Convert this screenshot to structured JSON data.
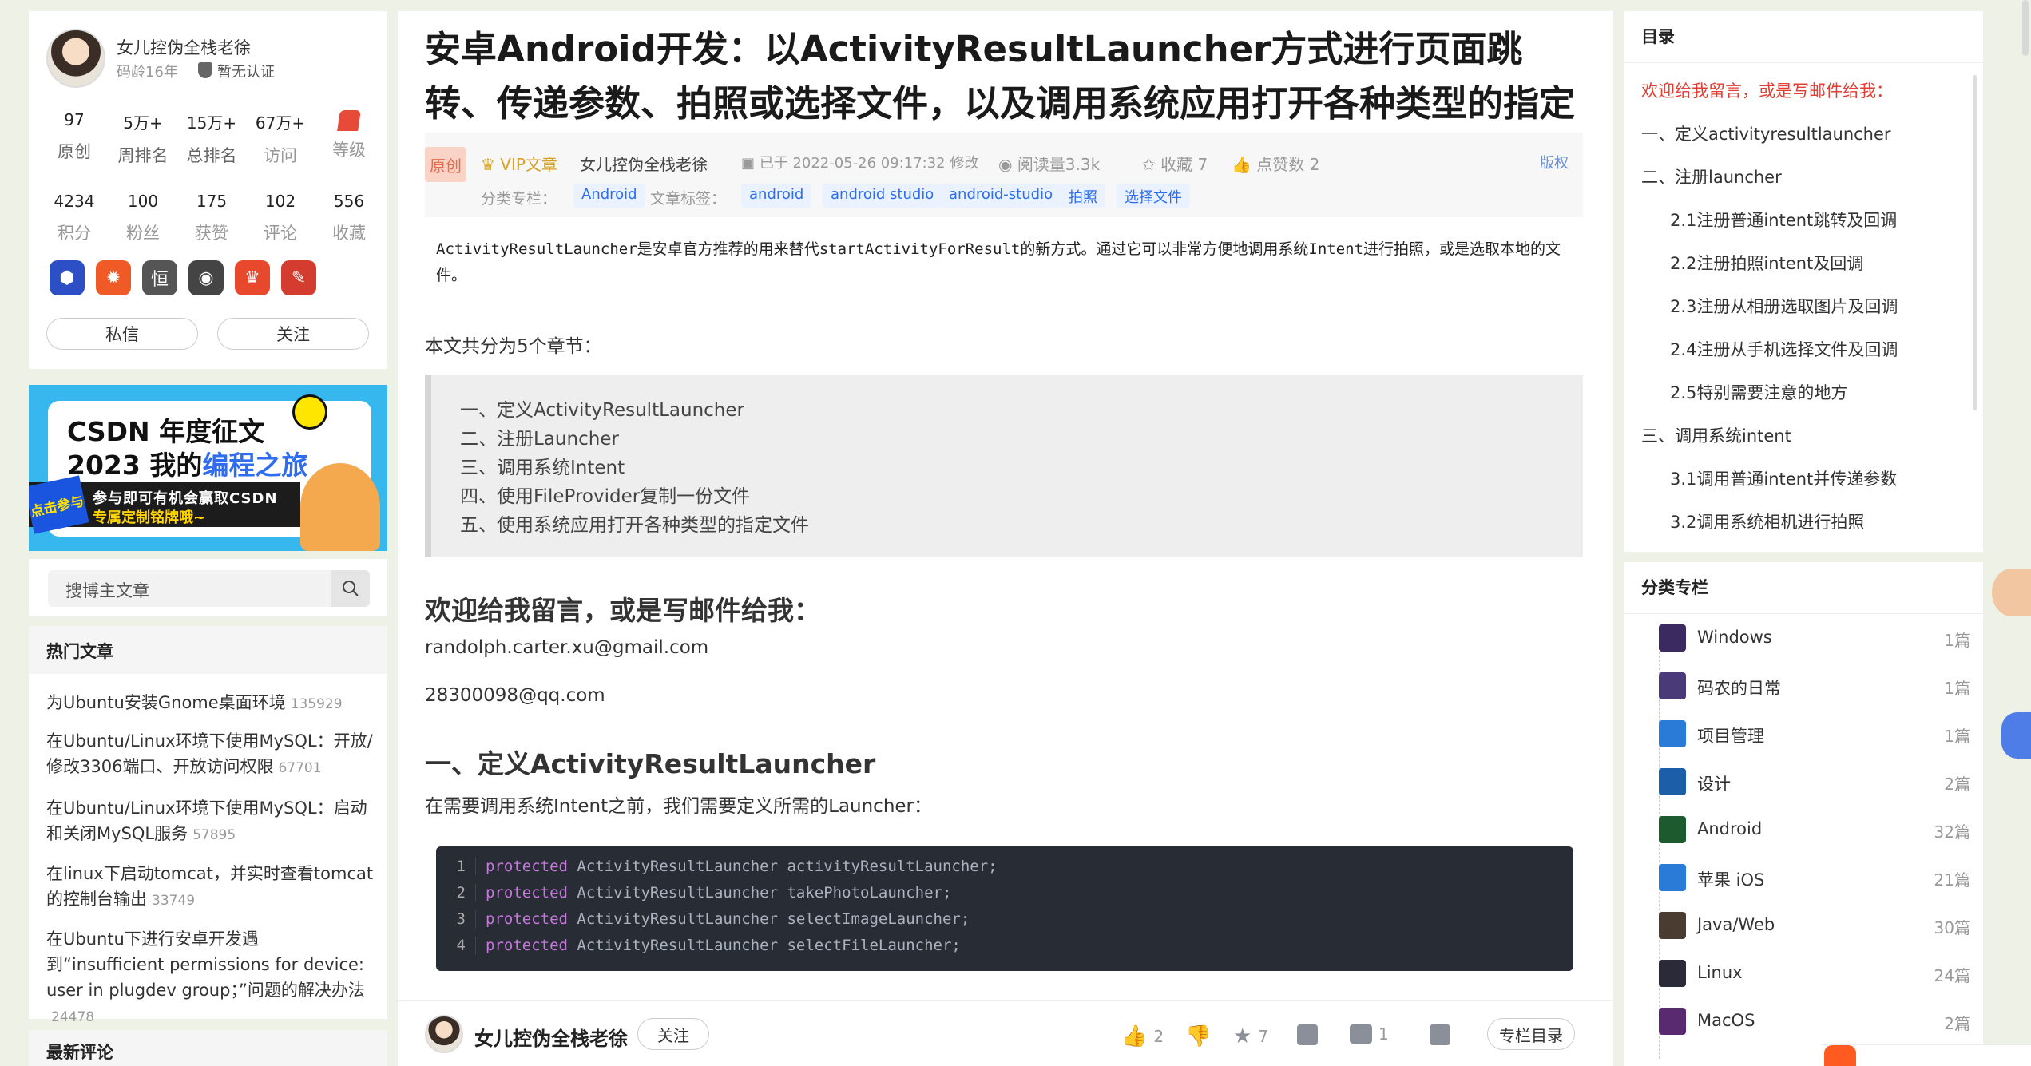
{
  "profile": {
    "name": "女儿控伪全栈老徐",
    "age": "码龄16年",
    "cert": "暂无认证",
    "stats_row1": [
      {
        "n": "97",
        "l": "原创"
      },
      {
        "n": "5万+",
        "l": "周排名"
      },
      {
        "n": "15万+",
        "l": "总排名"
      },
      {
        "n": "67万+",
        "l": "访问"
      },
      {
        "n": "",
        "l": "等级"
      }
    ],
    "stats_row2": [
      {
        "n": "4234",
        "l": "积分"
      },
      {
        "n": "100",
        "l": "粉丝"
      },
      {
        "n": "175",
        "l": "获赞"
      },
      {
        "n": "102",
        "l": "评论"
      },
      {
        "n": "556",
        "l": "收藏"
      }
    ],
    "msg_btn": "私信",
    "follow_btn": "关注"
  },
  "banner": {
    "line1": "CSDN 年度征文",
    "line2a": "2023 我的",
    "line2b": "编程之旅",
    "burst": "点击参与",
    "s1": "参与即可有机会赢取CSDN",
    "s2": "专属定制铭牌哦~"
  },
  "search": {
    "placeholder": "搜博主文章"
  },
  "hot": {
    "title": "热门文章",
    "items": [
      {
        "t": "为Ubuntu安装Gnome桌面环境",
        "v": "135929"
      },
      {
        "t": "在Ubuntu/Linux环境下使用MySQL：开放/修改3306端口、开放访问权限",
        "v": "67701"
      },
      {
        "t": "在Ubuntu/Linux环境下使用MySQL：启动和关闭MySQL服务",
        "v": "57895"
      },
      {
        "t": "在linux下启动tomcat，并实时查看tomcat的控制台输出",
        "v": "33749"
      },
      {
        "t": "在Ubuntu下进行安卓开发遇到“insufficient permissions for device: user in plugdev group；”问题的解决办法",
        "v": "24478"
      }
    ]
  },
  "comments": {
    "title": "最新评论"
  },
  "article": {
    "title": "安卓Android开发：以ActivityResultLauncher方式进行页面跳转、传递参数、拍照或选择文件，以及调用系统应用打开各种类型的指定文件",
    "orig": "原创",
    "vip": "VIP文章",
    "author": "女儿控伪全栈老徐",
    "modified": "已于 2022-05-26 09:17:32 修改",
    "reads": "阅读量3.3k",
    "fav": "收藏 7",
    "likes": "点赞数 2",
    "copyright": "版权",
    "col_label": "分类专栏：",
    "col_tag": "Android",
    "tag_label": "文章标签：",
    "tags": [
      "android",
      "android studio",
      "android-studio",
      "拍照",
      "选择文件"
    ],
    "intro_a": "ActivityResultLauncher",
    "intro_b": "是安卓官方推荐的用来替代",
    "intro_c": "startActivityForResult",
    "intro_d": "的新方式。通过它可以非常方便地调用系统",
    "intro_e": "Intent",
    "intro_f": "进行拍照，或是选取本地的文件。",
    "chapters_intro": "本文共分为5个章节：",
    "chapters": [
      "一、定义ActivityResultLauncher",
      "二、注册Launcher",
      "三、调用系统Intent",
      "四、使用FileProvider复制一份文件",
      "五、使用系统应用打开各种类型的指定文件"
    ],
    "welcome": "欢迎给我留言，或是写邮件给我：",
    "email1": "randolph.carter.xu@gmail.com",
    "email2": "28300098@qq.com",
    "h_define": "一、定义ActivityResultLauncher",
    "define_text": "在需要调用系统Intent之前，我们需要定义所需的Launcher：",
    "code": [
      {
        "ln": "1",
        "kw": "protected",
        "rest": " ActivityResultLauncher activityResultLauncher;"
      },
      {
        "ln": "2",
        "kw": "protected",
        "rest": " ActivityResultLauncher takePhotoLauncher;"
      },
      {
        "ln": "3",
        "kw": "protected",
        "rest": " ActivityResultLauncher selectImageLauncher;"
      },
      {
        "ln": "4",
        "kw": "protected",
        "rest": " ActivityResultLauncher selectFileLauncher;"
      }
    ]
  },
  "bottom": {
    "author": "女儿控伪全栈老徐",
    "follow": "关注",
    "like": "2",
    "fav": "7",
    "comment": "1",
    "column": "专栏目录"
  },
  "toc": {
    "title": "目录",
    "items": [
      "欢迎给我留言，或是写邮件给我：",
      "一、定义activityresultlauncher",
      "二、注册launcher",
      "2.1注册普通intent跳转及回调",
      "2.2注册拍照intent及回调",
      "2.3注册从相册选取图片及回调",
      "2.4注册从手机选择文件及回调",
      "2.5特别需要注意的地方",
      "三、调用系统intent",
      "3.1调用普通intent并传递参数",
      "3.2调用系统相机进行拍照"
    ]
  },
  "cats": {
    "title": "分类专栏",
    "items": [
      {
        "n": "Windows",
        "c": "1篇",
        "col": "#3a2a60"
      },
      {
        "n": "码农的日常",
        "c": "1篇",
        "col": "#4a3a78"
      },
      {
        "n": "项目管理",
        "c": "1篇",
        "col": "#2a7ad8"
      },
      {
        "n": "设计",
        "c": "2篇",
        "col": "#1c5ea8"
      },
      {
        "n": "Android",
        "c": "32篇",
        "col": "#1d5a2e"
      },
      {
        "n": "苹果 iOS",
        "c": "21篇",
        "col": "#2a7ad8"
      },
      {
        "n": "Java/Web",
        "c": "30篇",
        "col": "#4a3c30"
      },
      {
        "n": "Linux",
        "c": "24篇",
        "col": "#2a2a38"
      },
      {
        "n": "MacOS",
        "c": "2篇",
        "col": "#5a2a70"
      }
    ]
  }
}
